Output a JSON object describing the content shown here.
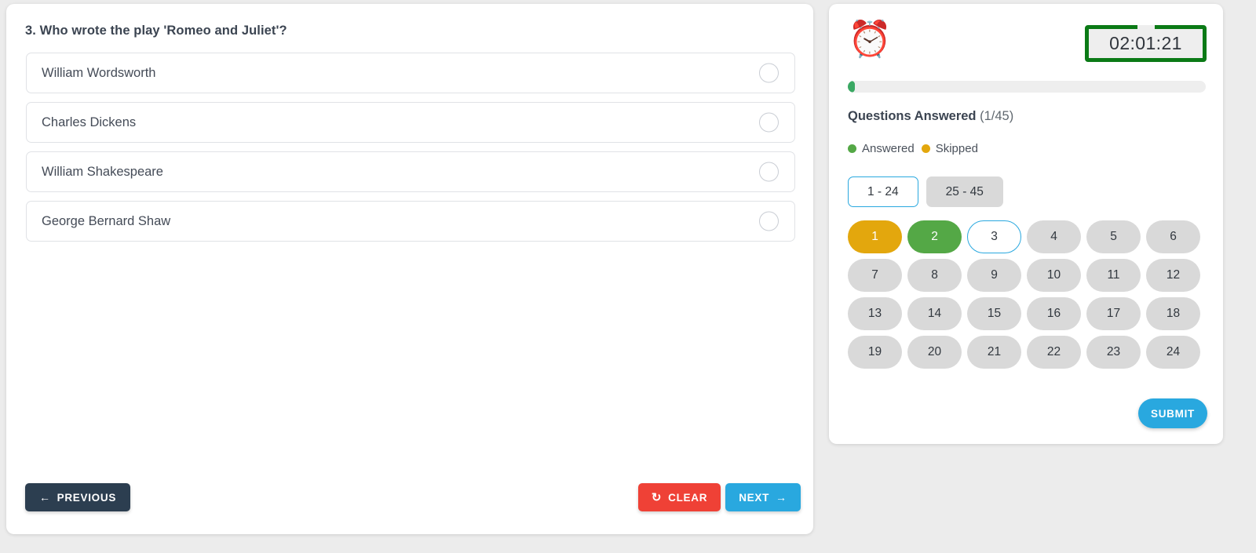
{
  "question": {
    "title": "3. Who wrote the play 'Romeo and Juliet'?",
    "options": [
      {
        "label": "William Wordsworth",
        "selected": false
      },
      {
        "label": "Charles Dickens",
        "selected": false
      },
      {
        "label": "William Shakespeare",
        "selected": false
      },
      {
        "label": "George Bernard Shaw",
        "selected": false
      }
    ]
  },
  "footer": {
    "previous_label": "PREVIOUS",
    "previous_icon": "arrow-left-icon",
    "clear_label": "CLEAR",
    "clear_icon": "reset-icon",
    "next_label": "NEXT",
    "next_icon": "arrow-right-icon"
  },
  "sidebar": {
    "clock_icon": "alarm-clock-icon",
    "timer": "02:01:21",
    "progress_percent": 2,
    "answered_label": "Questions Answered",
    "answered_count": "(1/45)",
    "answered_current": 1,
    "answered_total": 45,
    "legend": [
      {
        "label": "Answered",
        "color": "#54a846"
      },
      {
        "label": "Skipped",
        "color": "#e3a70d"
      }
    ],
    "range_tabs": [
      {
        "label": "1 - 24",
        "active": true
      },
      {
        "label": "25 - 45",
        "active": false
      }
    ],
    "questions": [
      {
        "number": "1",
        "state": "skipped"
      },
      {
        "number": "2",
        "state": "answered"
      },
      {
        "number": "3",
        "state": "current"
      },
      {
        "number": "4",
        "state": "default"
      },
      {
        "number": "5",
        "state": "default"
      },
      {
        "number": "6",
        "state": "default"
      },
      {
        "number": "7",
        "state": "default"
      },
      {
        "number": "8",
        "state": "default"
      },
      {
        "number": "9",
        "state": "default"
      },
      {
        "number": "10",
        "state": "default"
      },
      {
        "number": "11",
        "state": "default"
      },
      {
        "number": "12",
        "state": "default"
      },
      {
        "number": "13",
        "state": "default"
      },
      {
        "number": "14",
        "state": "default"
      },
      {
        "number": "15",
        "state": "default"
      },
      {
        "number": "16",
        "state": "default"
      },
      {
        "number": "17",
        "state": "default"
      },
      {
        "number": "18",
        "state": "default"
      },
      {
        "number": "19",
        "state": "default"
      },
      {
        "number": "20",
        "state": "default"
      },
      {
        "number": "21",
        "state": "default"
      },
      {
        "number": "22",
        "state": "default"
      },
      {
        "number": "23",
        "state": "default"
      },
      {
        "number": "24",
        "state": "default"
      }
    ],
    "submit_label": "SUBMIT"
  },
  "colors": {
    "accent_blue": "#29a8df",
    "answered_green": "#54a846",
    "skipped_amber": "#e3a70d",
    "clear_red": "#ef4136",
    "previous_navy": "#2c3e50",
    "timer_green": "#0b7a16"
  }
}
